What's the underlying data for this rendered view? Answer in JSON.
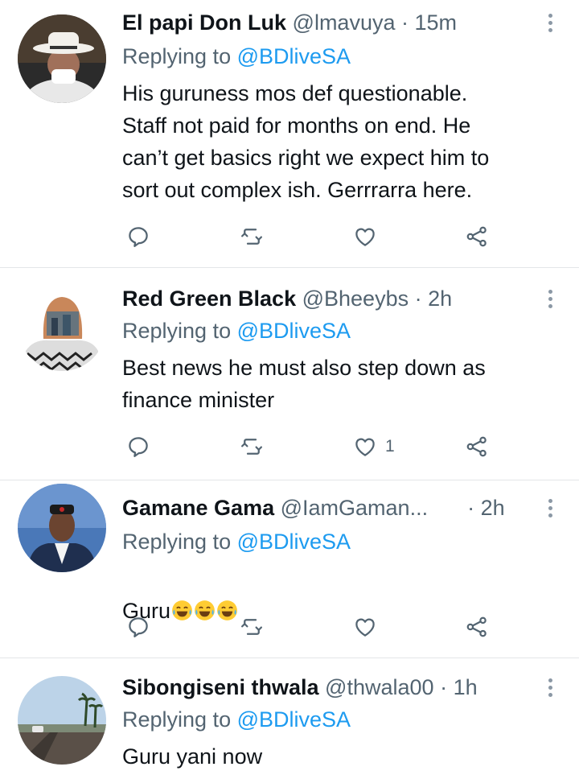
{
  "tweets": [
    {
      "name": "El papi Don Luk",
      "handle": "@lmavuya",
      "dot": "·",
      "time": "15m",
      "replying_prefix": "Replying to",
      "replying_to": "@BDliveSA",
      "text": "His guruness mos def questionable.\nStaff not paid for months on end. He\ncan’t get basics right we expect him to\nsort out complex ish. Gerrrarra here.",
      "like_count": ""
    },
    {
      "name": "Red Green Black",
      "handle": "@Bheeybs",
      "dot": "·",
      "time": "2h",
      "replying_prefix": "Replying to",
      "replying_to": "@BDliveSA",
      "text": "Best news he must also step down as\nfinance minister",
      "like_count": "1"
    },
    {
      "name": "Gamane Gama",
      "handle": "@IamGaman...",
      "dot": "·",
      "time": "2h",
      "replying_prefix": "Replying to",
      "replying_to": "@BDliveSA",
      "text": "Guru",
      "emoji": "face-with-tears-of-joy",
      "emoji_count": 3,
      "like_count": ""
    },
    {
      "name": "Sibongiseni thwala",
      "handle": "@thwala00",
      "dot": "·",
      "time": "1h",
      "replying_prefix": "Replying to",
      "replying_to": "@BDliveSA",
      "text": "Guru yani now",
      "like_count": ""
    }
  ],
  "colors": {
    "text": "#0f1419",
    "secondary": "#536471",
    "link": "#1d9bf0",
    "divider": "#e3e6e8"
  },
  "icons": [
    "reply-icon",
    "retweet-icon",
    "like-icon",
    "share-icon",
    "more-options-icon"
  ]
}
